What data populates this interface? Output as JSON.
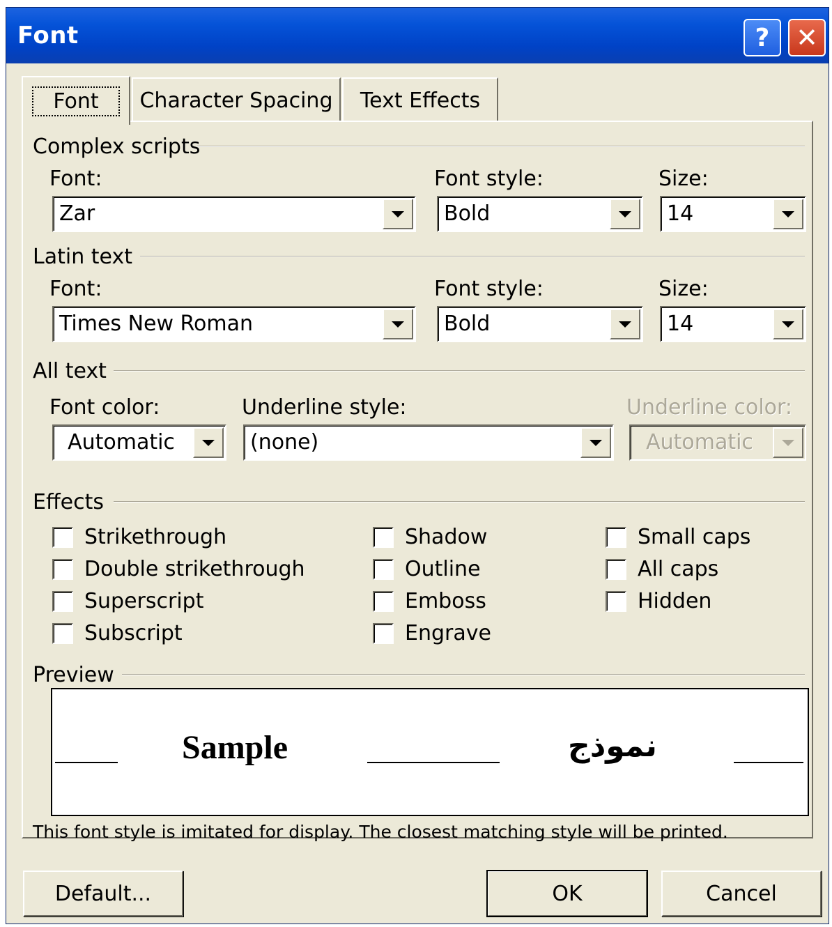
{
  "window": {
    "title": "Font",
    "help_glyph": "?",
    "close_glyph": "✕"
  },
  "tabs": [
    {
      "label": "Font",
      "active": true
    },
    {
      "label": "Character Spacing",
      "active": false
    },
    {
      "label": "Text Effects",
      "active": false
    }
  ],
  "complex_scripts": {
    "heading": "Complex scripts",
    "font_label": "Font:",
    "font_value": "Zar",
    "style_label": "Font style:",
    "style_value": "Bold",
    "size_label": "Size:",
    "size_value": "14"
  },
  "latin_text": {
    "heading": "Latin text",
    "font_label": "Font:",
    "font_value": "Times New Roman",
    "style_label": "Font style:",
    "style_value": "Bold",
    "size_label": "Size:",
    "size_value": "14"
  },
  "all_text": {
    "heading": "All text",
    "color_label": "Font color:",
    "color_value": "Automatic",
    "underline_label": "Underline style:",
    "underline_value": "(none)",
    "underline_color_label": "Underline color:",
    "underline_color_value": "Automatic"
  },
  "effects": {
    "heading": "Effects",
    "items": [
      {
        "label": "Strikethrough",
        "checked": false
      },
      {
        "label": "Double strikethrough",
        "checked": false
      },
      {
        "label": "Superscript",
        "checked": false
      },
      {
        "label": "Subscript",
        "checked": false
      },
      {
        "label": "Shadow",
        "checked": false
      },
      {
        "label": "Outline",
        "checked": false
      },
      {
        "label": "Emboss",
        "checked": false
      },
      {
        "label": "Engrave",
        "checked": false
      },
      {
        "label": "Small caps",
        "checked": false
      },
      {
        "label": "All caps",
        "checked": false
      },
      {
        "label": "Hidden",
        "checked": false
      }
    ]
  },
  "preview": {
    "heading": "Preview",
    "latin_sample": "Sample",
    "complex_sample": "نموذج",
    "note": "This font style is imitated for display. The closest matching style will be printed."
  },
  "buttons": {
    "default": "Default...",
    "ok": "OK",
    "cancel": "Cancel"
  }
}
